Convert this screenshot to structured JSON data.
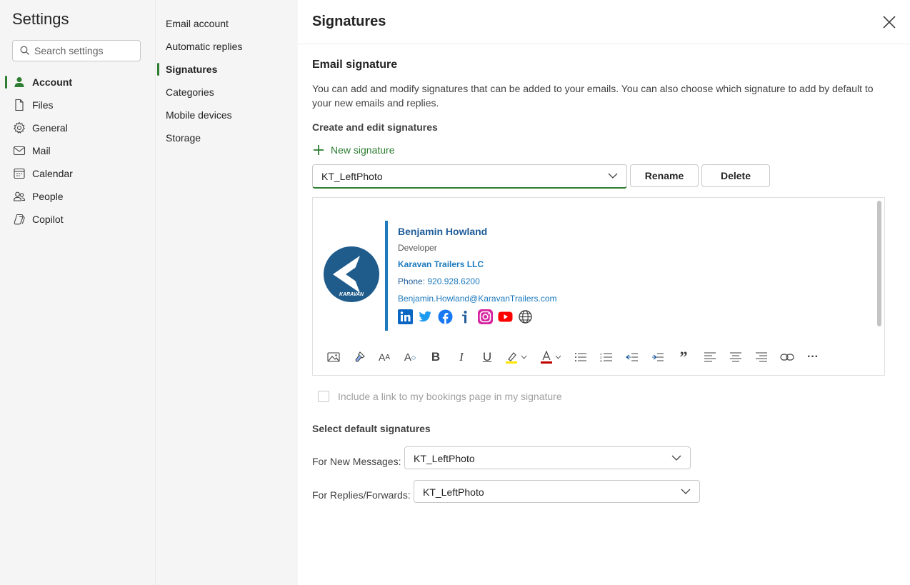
{
  "settings": {
    "title": "Settings",
    "search_placeholder": "Search settings"
  },
  "nav": [
    {
      "label": "Account",
      "icon": "person-icon",
      "active": true
    },
    {
      "label": "Files",
      "icon": "file-icon",
      "active": false
    },
    {
      "label": "General",
      "icon": "gear-icon",
      "active": false
    },
    {
      "label": "Mail",
      "icon": "mail-icon",
      "active": false
    },
    {
      "label": "Calendar",
      "icon": "calendar-icon",
      "active": false
    },
    {
      "label": "People",
      "icon": "people-icon",
      "active": false
    },
    {
      "label": "Copilot",
      "icon": "copilot-icon",
      "active": false
    }
  ],
  "subnav": [
    {
      "label": "Email account",
      "active": false
    },
    {
      "label": "Automatic replies",
      "active": false
    },
    {
      "label": "Signatures",
      "active": true
    },
    {
      "label": "Categories",
      "active": false
    },
    {
      "label": "Mobile devices",
      "active": false
    },
    {
      "label": "Storage",
      "active": false
    }
  ],
  "main": {
    "title": "Signatures",
    "section_title": "Email signature",
    "description": "You can add and modify signatures that can be added to your emails. You can also choose which signature to add by default to your new emails and replies.",
    "create_edit_label": "Create and edit signatures",
    "new_signature_label": "New signature",
    "selected_signature": "KT_LeftPhoto",
    "rename_label": "Rename",
    "delete_label": "Delete",
    "bookings_label": "Include a link to my bookings page in my signature",
    "default_title": "Select default signatures",
    "new_messages_label": "For New Messages:",
    "new_messages_value": "KT_LeftPhoto",
    "replies_label": "For Replies/Forwards:",
    "replies_value": "KT_LeftPhoto"
  },
  "signature": {
    "name": "Benjamin Howland",
    "job_title": "Developer",
    "company": "Karavan Trailers LLC",
    "phone_label": "Phone: ",
    "phone": "920.928.6200",
    "email": "Benjamin.Howland@KaravanTrailers.com",
    "logo_text": "KARAVAN",
    "social": [
      "linkedin-icon",
      "twitter-icon",
      "facebook-icon",
      "info-icon",
      "instagram-icon",
      "youtube-icon",
      "globe-icon"
    ]
  },
  "toolbar": [
    "insert-picture-icon",
    "format-painter-icon",
    "font-icon",
    "font-size-icon",
    "bold-icon",
    "italic-icon",
    "underline-icon",
    "highlight-icon",
    "font-color-icon",
    "bullets-icon",
    "numbering-icon",
    "decrease-indent-icon",
    "increase-indent-icon",
    "quote-icon",
    "align-left-icon",
    "align-center-icon",
    "align-right-icon",
    "link-icon",
    "more-icon"
  ],
  "colors": {
    "accent": "#2e7d32",
    "signature_blue": "#1d7abd",
    "signature_dark_blue": "#1f5c99"
  }
}
